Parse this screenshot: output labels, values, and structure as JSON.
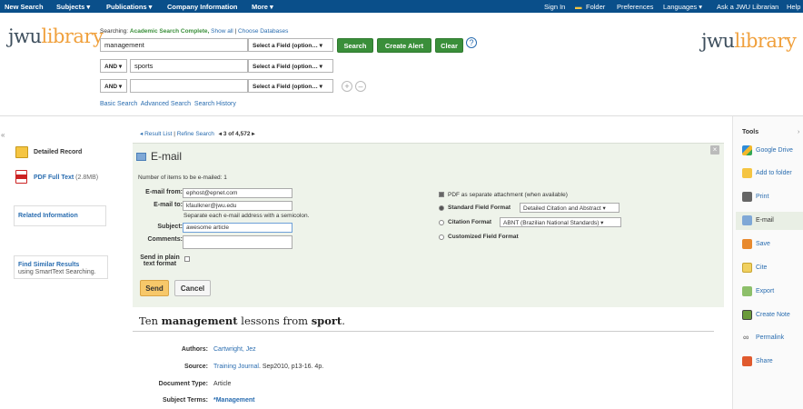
{
  "topnav": {
    "new_search": "New Search",
    "subjects": "Subjects ▾",
    "publications": "Publications ▾",
    "company": "Company Information",
    "more": "More ▾",
    "signin": "Sign In",
    "folder": "Folder",
    "prefs": "Preferences",
    "languages": "Languages ▾",
    "ask": "Ask a JWU Librarian",
    "help": "Help"
  },
  "brand": {
    "a": "jwu",
    "b": "library"
  },
  "search": {
    "searching_label": "Searching:",
    "database": "Academic Search Complete,",
    "show_all": "Show all",
    "choose": "Choose Databases",
    "row1_value": "management",
    "row2_value": "sports",
    "row3_value": "",
    "bool2": "AND ▾",
    "bool3": "AND ▾",
    "field_select": "Select a Field (option… ▾",
    "search_btn": "Search",
    "alert_btn": "Create Alert",
    "clear_btn": "Clear",
    "help": "?",
    "basic": "Basic Search",
    "advanced": "Advanced Search",
    "history": "Search History"
  },
  "left": {
    "collapse": "«",
    "detailed": "Detailed Record",
    "pdf": "PDF Full Text",
    "pdf_size": "(2.8MB)",
    "related": "Related Information",
    "find_similar": "Find Similar Results",
    "using": "using SmartText Searching."
  },
  "resultnav": {
    "result_list": "◂ Result List",
    "refine": "Refine Search",
    "position": "◂ 3 of 4,572 ▸"
  },
  "email": {
    "title": "E-mail",
    "count": "Number of items to be e-mailed: 1",
    "from_label": "E-mail from:",
    "from_value": "ephost@epnet.com",
    "to_label": "E-mail to:",
    "to_value": "kfaulkner@jwu.edu",
    "sep_hint": "Separate each e-mail address with a semicolon.",
    "subject_label": "Subject:",
    "subject_value": "awesome article",
    "comments_label": "Comments:",
    "plain_label_1": "Send in plain",
    "plain_label_2": "text format",
    "pdf_attach": "PDF as separate attachment (when available)",
    "std_format": "Standard Field Format",
    "std_value": "Detailed Citation and Abstract ▾",
    "cit_format": "Citation Format",
    "cit_value": "ABNT (Brazilian National Standards) ▾",
    "custom": "Customized Field Format",
    "send": "Send",
    "cancel": "Cancel",
    "close": "×"
  },
  "record": {
    "title_pre": "Ten ",
    "title_b1": "management",
    "title_mid": " lessons from ",
    "title_b2": "sport",
    "title_end": ".",
    "authors_label": "Authors:",
    "authors_value": "Cartwright, Jez",
    "source_label": "Source:",
    "source_link": "Training Journal",
    "source_rest": ". Sep2010, p13-16. 4p.",
    "doctype_label": "Document Type:",
    "doctype_value": "Article",
    "subject_label": "Subject Terms:",
    "subject_value": "*Management"
  },
  "tools": {
    "title": "Tools",
    "expand": "›",
    "gdrive": "Google Drive",
    "folder": "Add to folder",
    "print": "Print",
    "email": "E-mail",
    "save": "Save",
    "cite": "Cite",
    "export": "Export",
    "note": "Create Note",
    "permalink": "Permalink",
    "share": "Share"
  }
}
